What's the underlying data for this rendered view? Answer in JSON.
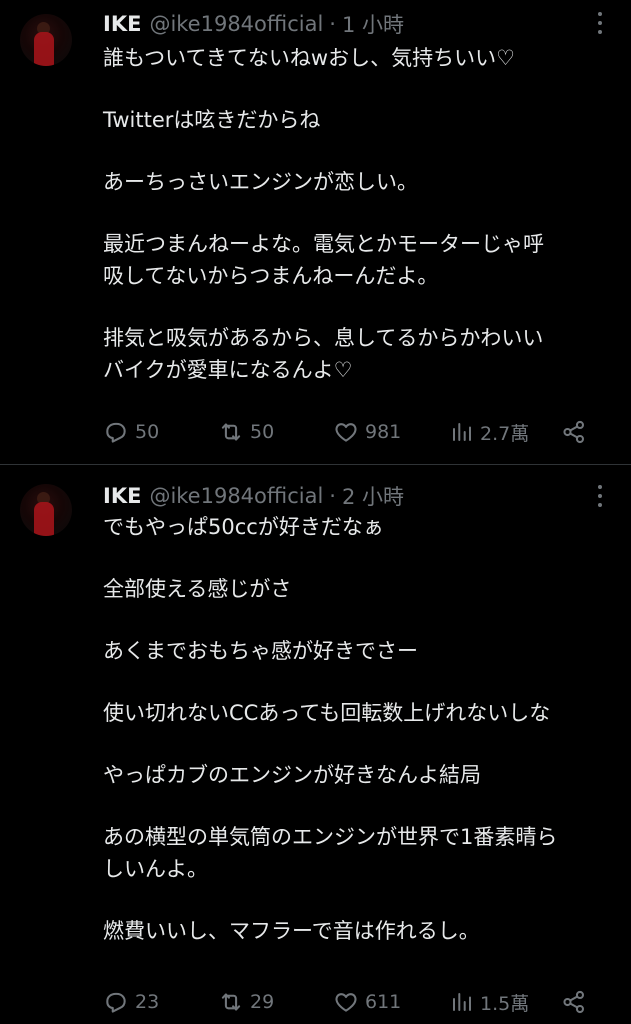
{
  "tweets": [
    {
      "author": {
        "name": "IKE",
        "handle": "@ike1984official",
        "separator": "·",
        "time": "1 小時"
      },
      "paragraphs": [
        [
          "誰もついてきてないねwおし、気持ちいい♡"
        ],
        [
          "Twitterは呟きだからね"
        ],
        [
          "あーちっさいエンジンが恋しい。"
        ],
        [
          "最近つまんねーよな。電気とかモーターじゃ呼",
          "吸してないからつまんねーんだよ。"
        ],
        [
          "排気と吸気があるから、息してるからかわいい",
          "バイクが愛車になるんよ♡"
        ]
      ],
      "stats": {
        "replies": "50",
        "retweets": "50",
        "likes": "981",
        "views": "2.7萬"
      }
    },
    {
      "author": {
        "name": "IKE",
        "handle": "@ike1984official",
        "separator": "·",
        "time": "2 小時"
      },
      "paragraphs": [
        [
          "でもやっぱ50ccが好きだなぁ"
        ],
        [
          "全部使える感じがさ"
        ],
        [
          "あくまでおもちゃ感が好きでさー"
        ],
        [
          "使い切れないCCあっても回転数上げれないしな"
        ],
        [
          "やっぱカブのエンジンが好きなんよ結局"
        ],
        [
          "あの横型の単気筒のエンジンが世界で1番素晴ら",
          "しいんよ。"
        ],
        [
          "燃費いいし、マフラーで音は作れるし。"
        ]
      ],
      "stats": {
        "replies": "23",
        "retweets": "29",
        "likes": "611",
        "views": "1.5萬"
      }
    }
  ],
  "icons": {
    "reply": "reply-icon",
    "retweet": "retweet-icon",
    "like": "heart-icon",
    "views": "views-chart-icon",
    "share": "share-icon",
    "more": "more-dots-icon"
  },
  "colors": {
    "background": "#000000",
    "text_primary": "#e7e9ea",
    "text_secondary": "#71767b",
    "divider": "#2f3336",
    "avatar_accent": "#a3141a"
  }
}
